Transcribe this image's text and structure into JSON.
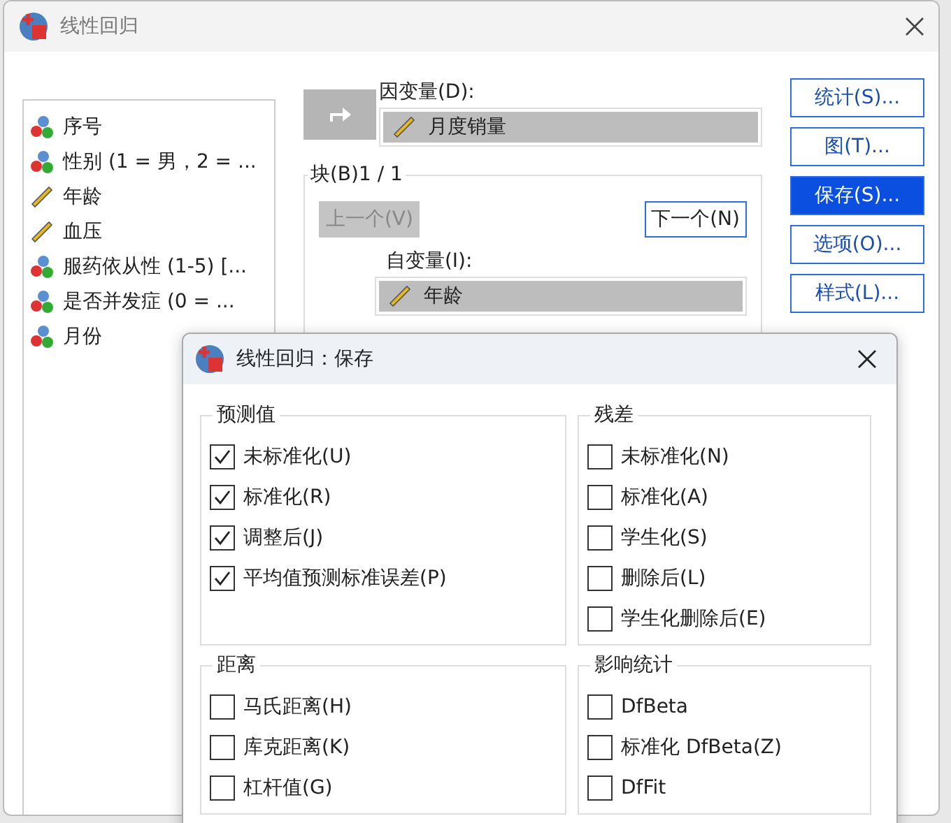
{
  "window": {
    "title": "线性回归"
  },
  "variables": [
    {
      "label": "序号",
      "kind": "nominal"
    },
    {
      "label": "性别 (1 = 男，2 = ...",
      "kind": "nominal"
    },
    {
      "label": "年龄",
      "kind": "scale"
    },
    {
      "label": "血压",
      "kind": "scale"
    },
    {
      "label": "服药依从性 (1-5) [...",
      "kind": "nominal"
    },
    {
      "label": "是否并发症 (0 = ...",
      "kind": "nominal"
    },
    {
      "label": "月份",
      "kind": "nominal"
    }
  ],
  "dependent": {
    "label": "因变量(D):",
    "value": {
      "label": "月度销量",
      "kind": "scale"
    }
  },
  "block": {
    "label": "块(B)1 / 1",
    "previous": {
      "label": "上一个(V)",
      "disabled": true
    },
    "next": {
      "label": "下一个(N)",
      "disabled": false
    },
    "independent_label": "自变量(I):",
    "independents": [
      {
        "label": "年龄",
        "kind": "scale"
      }
    ]
  },
  "buttons": [
    {
      "label": "统计(S)...",
      "selected": false
    },
    {
      "label": "图(T)...",
      "selected": false
    },
    {
      "label": "保存(S)...",
      "selected": true
    },
    {
      "label": "选项(O)...",
      "selected": false
    },
    {
      "label": "样式(L)...",
      "selected": false
    }
  ],
  "save_dialog": {
    "title": "线性回归：保存",
    "groups": [
      {
        "title": "预测值",
        "options": [
          {
            "label": "未标准化(U)",
            "checked": true
          },
          {
            "label": "标准化(R)",
            "checked": true
          },
          {
            "label": "调整后(J)",
            "checked": true
          },
          {
            "label": "平均值预测标准误差(P)",
            "checked": true
          }
        ]
      },
      {
        "title": "残差",
        "options": [
          {
            "label": "未标准化(N)",
            "checked": false
          },
          {
            "label": "标准化(A)",
            "checked": false
          },
          {
            "label": "学生化(S)",
            "checked": false
          },
          {
            "label": "删除后(L)",
            "checked": false
          },
          {
            "label": "学生化删除后(E)",
            "checked": false
          }
        ]
      },
      {
        "title": "距离",
        "options": [
          {
            "label": "马氏距离(H)",
            "checked": false
          },
          {
            "label": "库克距离(K)",
            "checked": false
          },
          {
            "label": "杠杆值(G)",
            "checked": false
          }
        ]
      },
      {
        "title": "影响统计",
        "options": [
          {
            "label": "DfBeta",
            "checked": false
          },
          {
            "label": "标准化 DfBeta(Z)",
            "checked": false
          },
          {
            "label": "DfFit",
            "checked": false
          }
        ]
      }
    ]
  }
}
